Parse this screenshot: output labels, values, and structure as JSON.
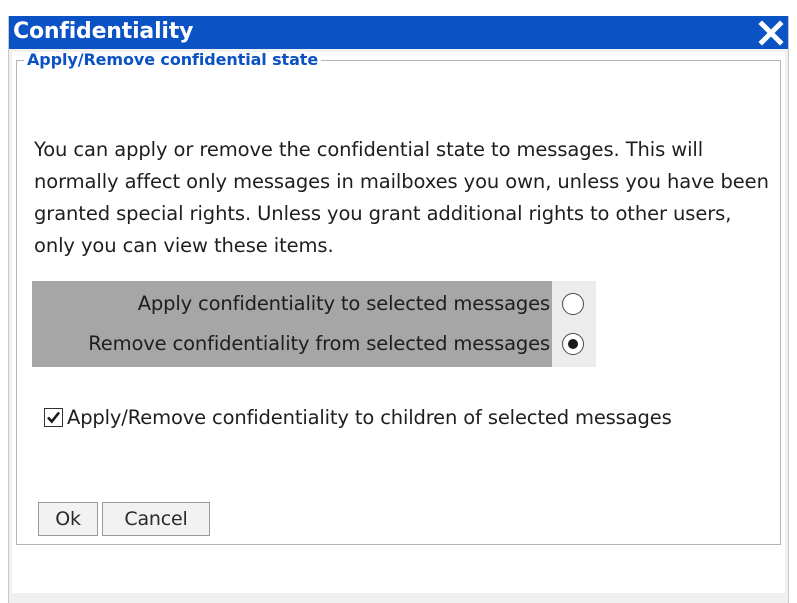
{
  "dialog": {
    "title": "Confidentiality",
    "close_icon": "close-x-icon",
    "colors": {
      "titlebar": "#0b52c4",
      "legend_text": "#0b52c4",
      "options_label_bg": "#a6a6a6"
    }
  },
  "group": {
    "legend": "Apply/Remove confidential state",
    "description": "You can apply or remove the confidential state to messages. This will normally affect only messages in mailboxes you own, unless you have been granted special rights. Unless you grant additional rights to other users, only you can view these items."
  },
  "options": [
    {
      "label": "Apply confidentiality to selected messages",
      "selected": false
    },
    {
      "label": "Remove confidentiality from selected messages",
      "selected": true
    }
  ],
  "children_option": {
    "label": "Apply/Remove confidentiality to children of selected messages",
    "checked": true
  },
  "buttons": {
    "ok": "Ok",
    "cancel": "Cancel"
  }
}
